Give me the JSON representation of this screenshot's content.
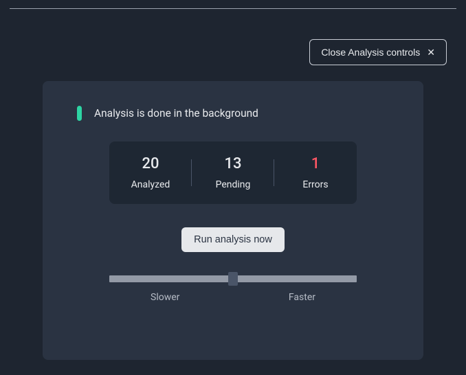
{
  "close_button": {
    "label": "Close Analysis controls"
  },
  "status": {
    "text": "Analysis is done in the background"
  },
  "stats": {
    "analyzed": {
      "value": "20",
      "label": "Analyzed"
    },
    "pending": {
      "value": "13",
      "label": "Pending"
    },
    "errors": {
      "value": "1",
      "label": "Errors"
    }
  },
  "run_button": {
    "label": "Run analysis now"
  },
  "slider": {
    "slower_label": "Slower",
    "faster_label": "Faster",
    "position_percent": 50
  },
  "colors": {
    "accent_green": "#2dd4a3",
    "error_red": "#ff5765"
  }
}
